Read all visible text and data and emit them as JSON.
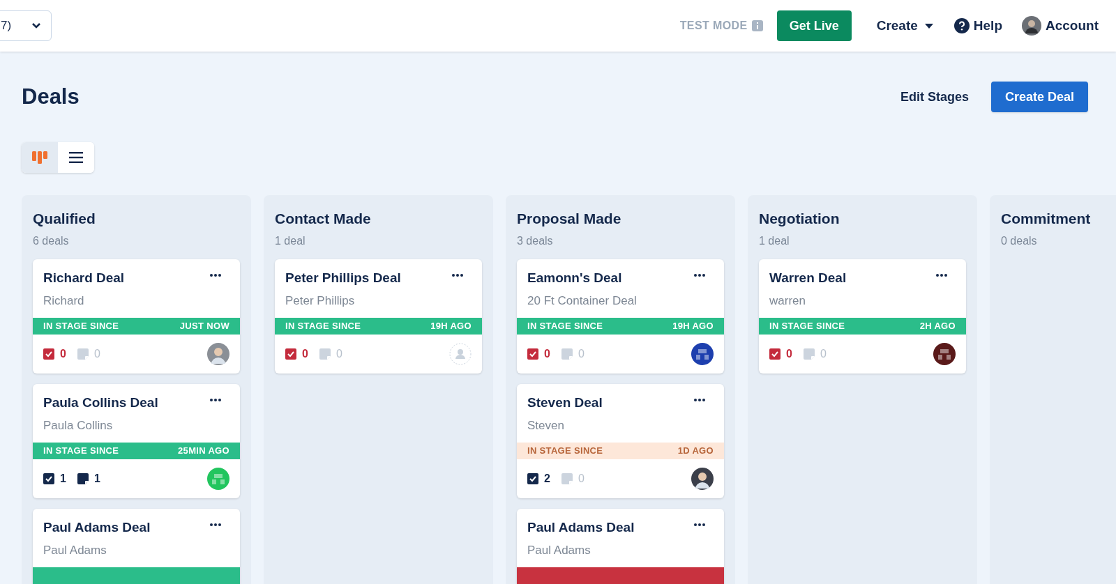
{
  "top_bar": {
    "selector": {
      "value": "7)"
    },
    "test_mode": "TEST MODE",
    "get_live": "Get Live",
    "create": "Create",
    "help": "Help",
    "account": "Account"
  },
  "header": {
    "title": "Deals",
    "edit_stages": "Edit Stages",
    "create_deal": "Create Deal"
  },
  "view_toggle": [
    {
      "kind": "board",
      "selected": true
    },
    {
      "kind": "list",
      "selected": false
    }
  ],
  "stages": [
    {
      "name": "Qualified",
      "count": "6 deals",
      "deals": [
        {
          "title": "Richard Deal",
          "contact": "Richard",
          "stage_bar": {
            "color": "#2bbd8a",
            "label": "IN STAGE SINCE",
            "time": "JUST NOW"
          },
          "tasks": {
            "count": "0",
            "overdue": true
          },
          "notes": {
            "count": "0",
            "active": false
          },
          "avatar": {
            "kind": "photo",
            "color": "#8a8f96"
          }
        },
        {
          "title": "Paula Collins Deal",
          "contact": "Paula Collins",
          "stage_bar": {
            "color": "#2bbd8a",
            "label": "IN STAGE SINCE",
            "time": "25MIN AGO"
          },
          "tasks": {
            "count": "1",
            "overdue": false
          },
          "notes": {
            "count": "1",
            "active": true
          },
          "avatar": {
            "kind": "pattern",
            "color": "#22c55e"
          }
        },
        {
          "title": "Paul Adams Deal",
          "contact": "Paul Adams",
          "stage_bar": {
            "color": "#2bbd8a"
          }
        }
      ]
    },
    {
      "name": "Contact Made",
      "count": "1 deal",
      "deals": [
        {
          "title": "Peter Phillips Deal",
          "contact": "Peter Phillips",
          "stage_bar": {
            "color": "#2bbd8a",
            "label": "IN STAGE SINCE",
            "time": "19H AGO"
          },
          "tasks": {
            "count": "0",
            "overdue": true
          },
          "notes": {
            "count": "0",
            "active": false
          },
          "avatar": {
            "kind": "placeholder"
          }
        }
      ]
    },
    {
      "name": "Proposal Made",
      "count": "3 deals",
      "deals": [
        {
          "title": "Eamonn's Deal",
          "contact": "20 Ft Container Deal",
          "stage_bar": {
            "color": "#2bbd8a",
            "label": "IN STAGE SINCE",
            "time": "19H AGO"
          },
          "tasks": {
            "count": "0",
            "overdue": true
          },
          "notes": {
            "count": "0",
            "active": false
          },
          "avatar": {
            "kind": "pattern",
            "color": "#1d3fae"
          }
        },
        {
          "title": "Steven Deal",
          "contact": "Steven",
          "stage_bar": {
            "color": "#fde7d9",
            "label": "IN STAGE SINCE",
            "time": "1D AGO"
          },
          "tasks": {
            "count": "2",
            "overdue": false
          },
          "notes": {
            "count": "0",
            "active": false
          },
          "avatar": {
            "kind": "photo",
            "color": "#3b3f4a"
          }
        },
        {
          "title": "Paul Adams Deal",
          "contact": "Paul Adams",
          "stage_bar": {
            "color": "#c8323f"
          }
        }
      ]
    },
    {
      "name": "Negotiation",
      "count": "1 deal",
      "deals": [
        {
          "title": "Warren Deal",
          "contact": "warren",
          "stage_bar": {
            "color": "#2bbd8a",
            "label": "IN STAGE SINCE",
            "time": "2H AGO"
          },
          "tasks": {
            "count": "0",
            "overdue": true
          },
          "notes": {
            "count": "0",
            "active": false
          },
          "avatar": {
            "kind": "pattern",
            "color": "#5a1a1a"
          }
        }
      ]
    },
    {
      "name": "Commitment",
      "count": "0 deals"
    }
  ]
}
